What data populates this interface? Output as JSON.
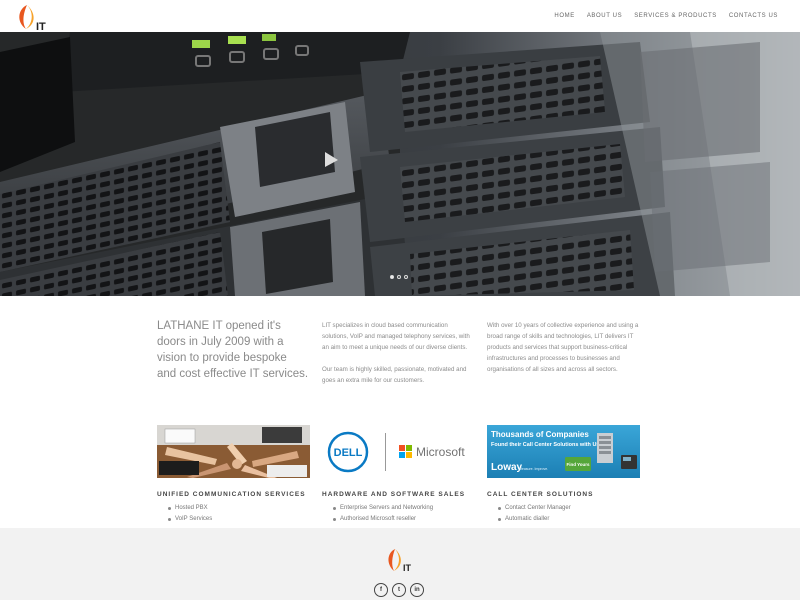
{
  "brand": {
    "logo_text": "IT",
    "accent": "#e8571f",
    "accent_light": "#f6a22a"
  },
  "nav": {
    "items": [
      {
        "label": "HOME"
      },
      {
        "label": "ABOUT US"
      },
      {
        "label": "SERVICES & PRODUCTS"
      },
      {
        "label": "CONTACTS US"
      }
    ]
  },
  "hero": {
    "slides": 3,
    "active_slide": 1
  },
  "intro": {
    "lead": "LATHANE IT opened it's doors in July 2009 with a vision to provide bespoke and cost effective IT services.",
    "col_a": [
      "LIT specializes in cloud based communication solutions, VoIP and managed telephony services, with an aim to meet a unique needs of our diverse clients.",
      "Our team is highly skilled, passionate, motivated and goes an extra mile for our customers."
    ],
    "col_b": "With over 10 years of collective experience and using a broad range of skills and technologies, LIT delivers IT products and services that support business-critical infrastructures and processes to businesses and organisations of all sizes and across all sectors."
  },
  "services": [
    {
      "title": "UNIFIED COMMUNICATION SERVICES",
      "items": [
        "Hosted PBX",
        "VoIP Services"
      ]
    },
    {
      "title": "HARDWARE AND SOFTWARE SALES",
      "items": [
        "Enterprise Servers and Networking",
        "Authorised Microsoft reseller"
      ],
      "logo_a": "DELL",
      "logo_b": "Microsoft"
    },
    {
      "title": "CALL CENTER SOLUTIONS",
      "items": [
        "Contact Center Manager",
        "Automatic dialler"
      ],
      "banner_title": "Thousands of Companies",
      "banner_sub": "Found their Call Center Solutions with Us",
      "banner_brand": "Loway",
      "banner_tag": "Measure. Improve.",
      "banner_button": "Find Yours"
    }
  ],
  "footer": {
    "social": [
      "f",
      "t",
      "in"
    ],
    "social_icons": [
      "facebook-icon",
      "twitter-icon",
      "linkedin-icon"
    ]
  }
}
